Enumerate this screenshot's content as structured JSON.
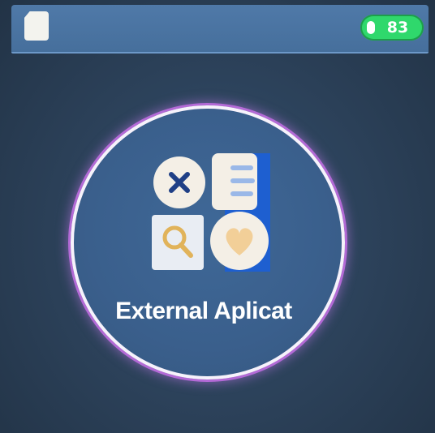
{
  "status_bar": {
    "sim_icon": "sim-card-icon",
    "battery_level": "83",
    "battery_icon": "battery-icon"
  },
  "main": {
    "app_label": "External Aplicat",
    "app_icon": "apps-grid-icon",
    "colors": {
      "background": "#2c3f56",
      "circle_fill": "#3a5f8c",
      "circle_glow": "#b36ad6",
      "battery": "#2fd86c",
      "icon_accent": "#1e5fd0",
      "icon_x": "#1f3f86",
      "icon_heart": "#f2cf98"
    }
  }
}
